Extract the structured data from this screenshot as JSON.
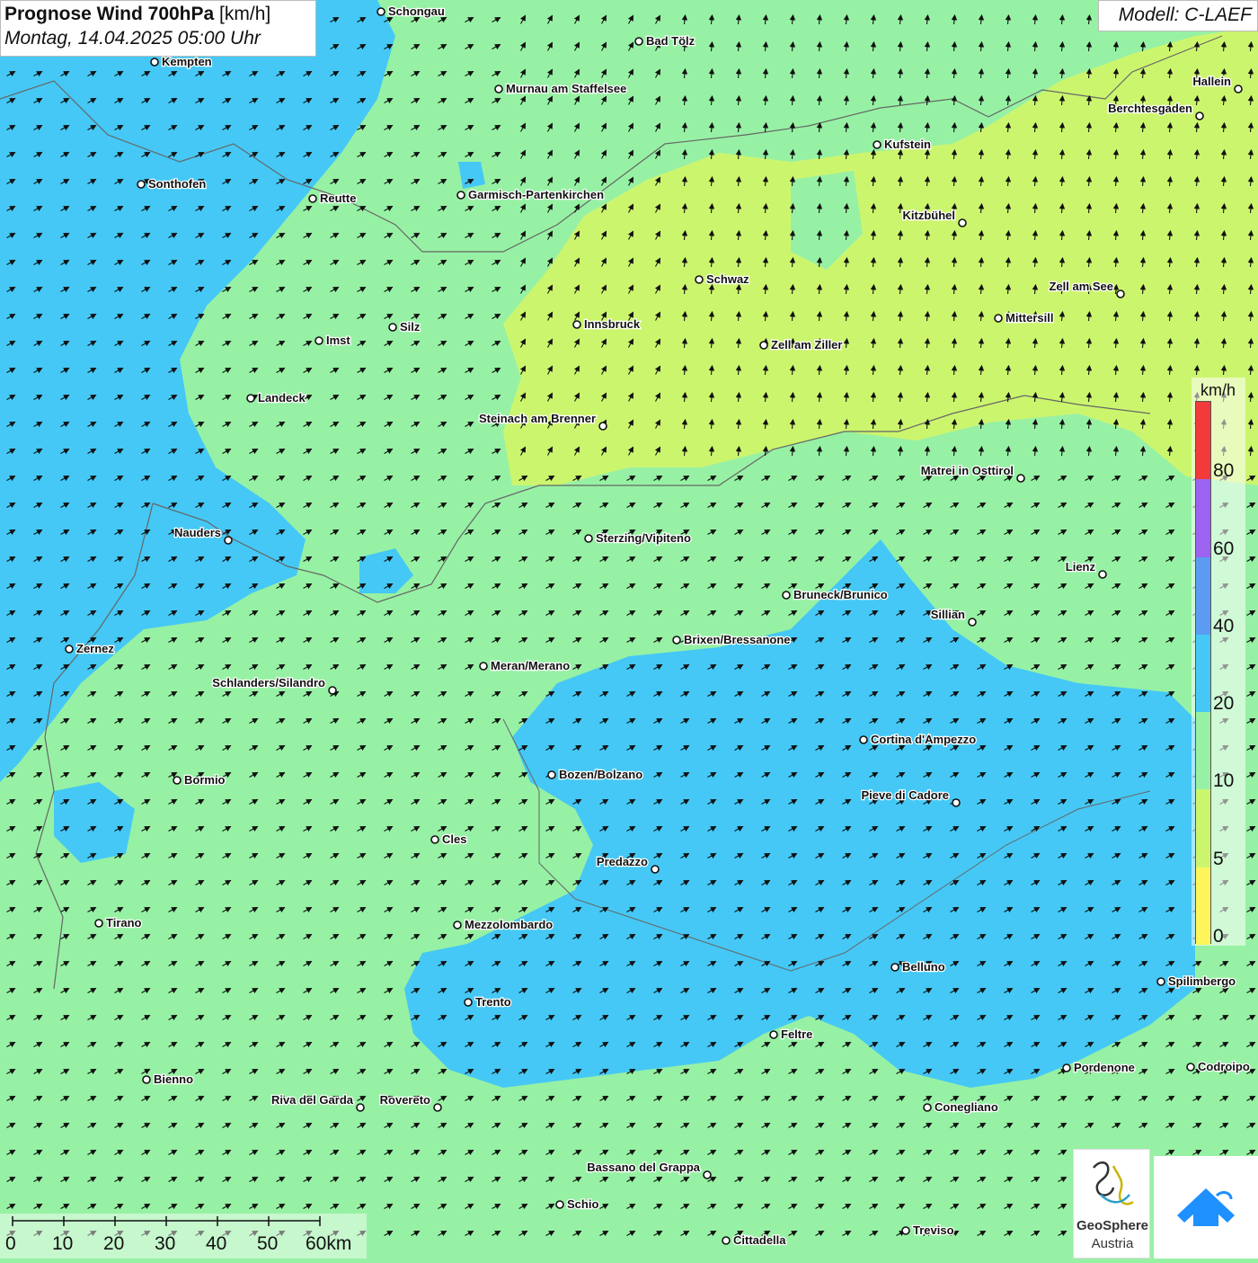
{
  "header": {
    "title_bold": "Prognose Wind 700hPa",
    "title_unit": "[km/h]",
    "datetime": "Montag, 14.04.2025 05:00 Uhr",
    "model": "Modell: C-LAEF"
  },
  "legend": {
    "unit": "km/h",
    "bins": [
      {
        "from": 0,
        "to": 5,
        "color": "#fdf55a"
      },
      {
        "from": 5,
        "to": 10,
        "color": "#ccf56e"
      },
      {
        "from": 10,
        "to": 20,
        "color": "#97f1a4"
      },
      {
        "from": 20,
        "to": 40,
        "color": "#45c8f5"
      },
      {
        "from": 40,
        "to": 60,
        "color": "#5b9cf2"
      },
      {
        "from": 60,
        "to": 80,
        "color": "#9b63f0"
      },
      {
        "from": 80,
        "to": 100,
        "color": "#f23a3a"
      }
    ],
    "tick_labels": [
      "0",
      "5",
      "10",
      "20",
      "40",
      "60",
      "80"
    ]
  },
  "scale_bar": {
    "labels": [
      "0",
      "10",
      "20",
      "30",
      "40",
      "50",
      "60km"
    ]
  },
  "cities": [
    {
      "name": "Schongau"
    },
    {
      "name": "Bad Tölz"
    },
    {
      "name": "Kempten"
    },
    {
      "name": "Murnau am Staffelsee"
    },
    {
      "name": "Hallein"
    },
    {
      "name": "Berchtesgaden"
    },
    {
      "name": "Kufstein"
    },
    {
      "name": "Sonthofen"
    },
    {
      "name": "Reutte"
    },
    {
      "name": "Garmisch-Partenkirchen"
    },
    {
      "name": "Kitzbühel"
    },
    {
      "name": "Schwaz"
    },
    {
      "name": "Zell am See"
    },
    {
      "name": "Mittersill"
    },
    {
      "name": "Innsbruck"
    },
    {
      "name": "Silz"
    },
    {
      "name": "Imst"
    },
    {
      "name": "Zell am Ziller"
    },
    {
      "name": "Landeck"
    },
    {
      "name": "Steinach am Brenner"
    },
    {
      "name": "Matrei in Osttirol"
    },
    {
      "name": "Nauders"
    },
    {
      "name": "Sterzing/Vipiteno"
    },
    {
      "name": "Lienz"
    },
    {
      "name": "Bruneck/Brunico"
    },
    {
      "name": "Sillian"
    },
    {
      "name": "Brixen/Bressanone"
    },
    {
      "name": "Zernez"
    },
    {
      "name": "Meran/Merano"
    },
    {
      "name": "Schlanders/Silandro"
    },
    {
      "name": "Cortina d'Ampezzo"
    },
    {
      "name": "Bozen/Bolzano"
    },
    {
      "name": "Bormio"
    },
    {
      "name": "Pieve di Cadore"
    },
    {
      "name": "Cles"
    },
    {
      "name": "Predazzo"
    },
    {
      "name": "Tirano"
    },
    {
      "name": "Mezzolombardo"
    },
    {
      "name": "Belluno"
    },
    {
      "name": "Spilimbergo"
    },
    {
      "name": "Trento"
    },
    {
      "name": "Feltre"
    },
    {
      "name": "Pordenone"
    },
    {
      "name": "Codroipo"
    },
    {
      "name": "Bienno"
    },
    {
      "name": "Riva del Garda"
    },
    {
      "name": "Rovereto"
    },
    {
      "name": "Conegliano"
    },
    {
      "name": "Bassano del Grappa"
    },
    {
      "name": "Schio"
    },
    {
      "name": "Treviso"
    },
    {
      "name": "Cittadella"
    }
  ],
  "logos": {
    "geosphere_line1": "GeoSphere",
    "geosphere_line2": "Austria"
  }
}
